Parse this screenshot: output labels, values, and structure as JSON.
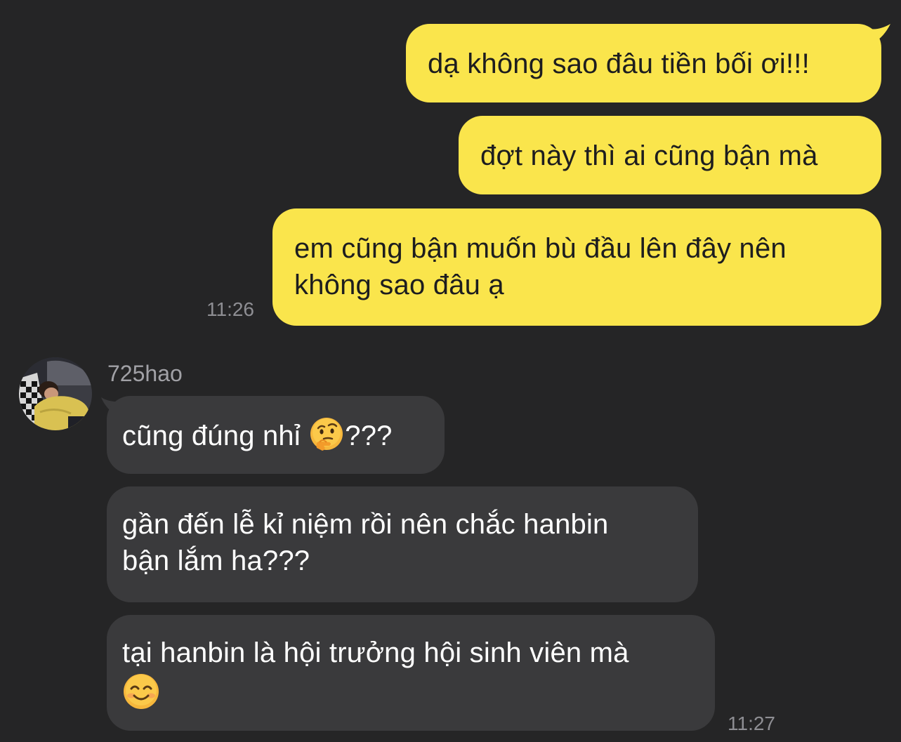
{
  "chat": {
    "outgoing": [
      {
        "text": "dạ không sao đâu tiền bối ơi!!!"
      },
      {
        "text": "đợt này thì ai cũng bận mà"
      },
      {
        "text_line1": "em cũng bận muốn bù đầu lên đây nên",
        "text_line2": "không sao đâu ạ"
      }
    ],
    "outgoing_time": "11:26",
    "contact": {
      "name": "725hao"
    },
    "incoming": [
      {
        "text": "cũng đúng nhỉ ",
        "emoji": "thinking-face-emoji",
        "suffix": "???"
      },
      {
        "text_line1": "gần đến lễ kỉ niệm rồi nên chắc hanbin",
        "text_line2": "bận lắm ha???"
      },
      {
        "text_line1": "tại hanbin là hội trưởng hội sinh viên mà",
        "emoji": "smiling-face-emoji"
      }
    ],
    "incoming_time": "11:27"
  },
  "colors": {
    "background": "#252526",
    "outgoing_bubble": "#fae54c",
    "incoming_bubble": "#3a3a3c",
    "timestamp": "#8e8e93",
    "sender_name": "#a1a1a6"
  }
}
